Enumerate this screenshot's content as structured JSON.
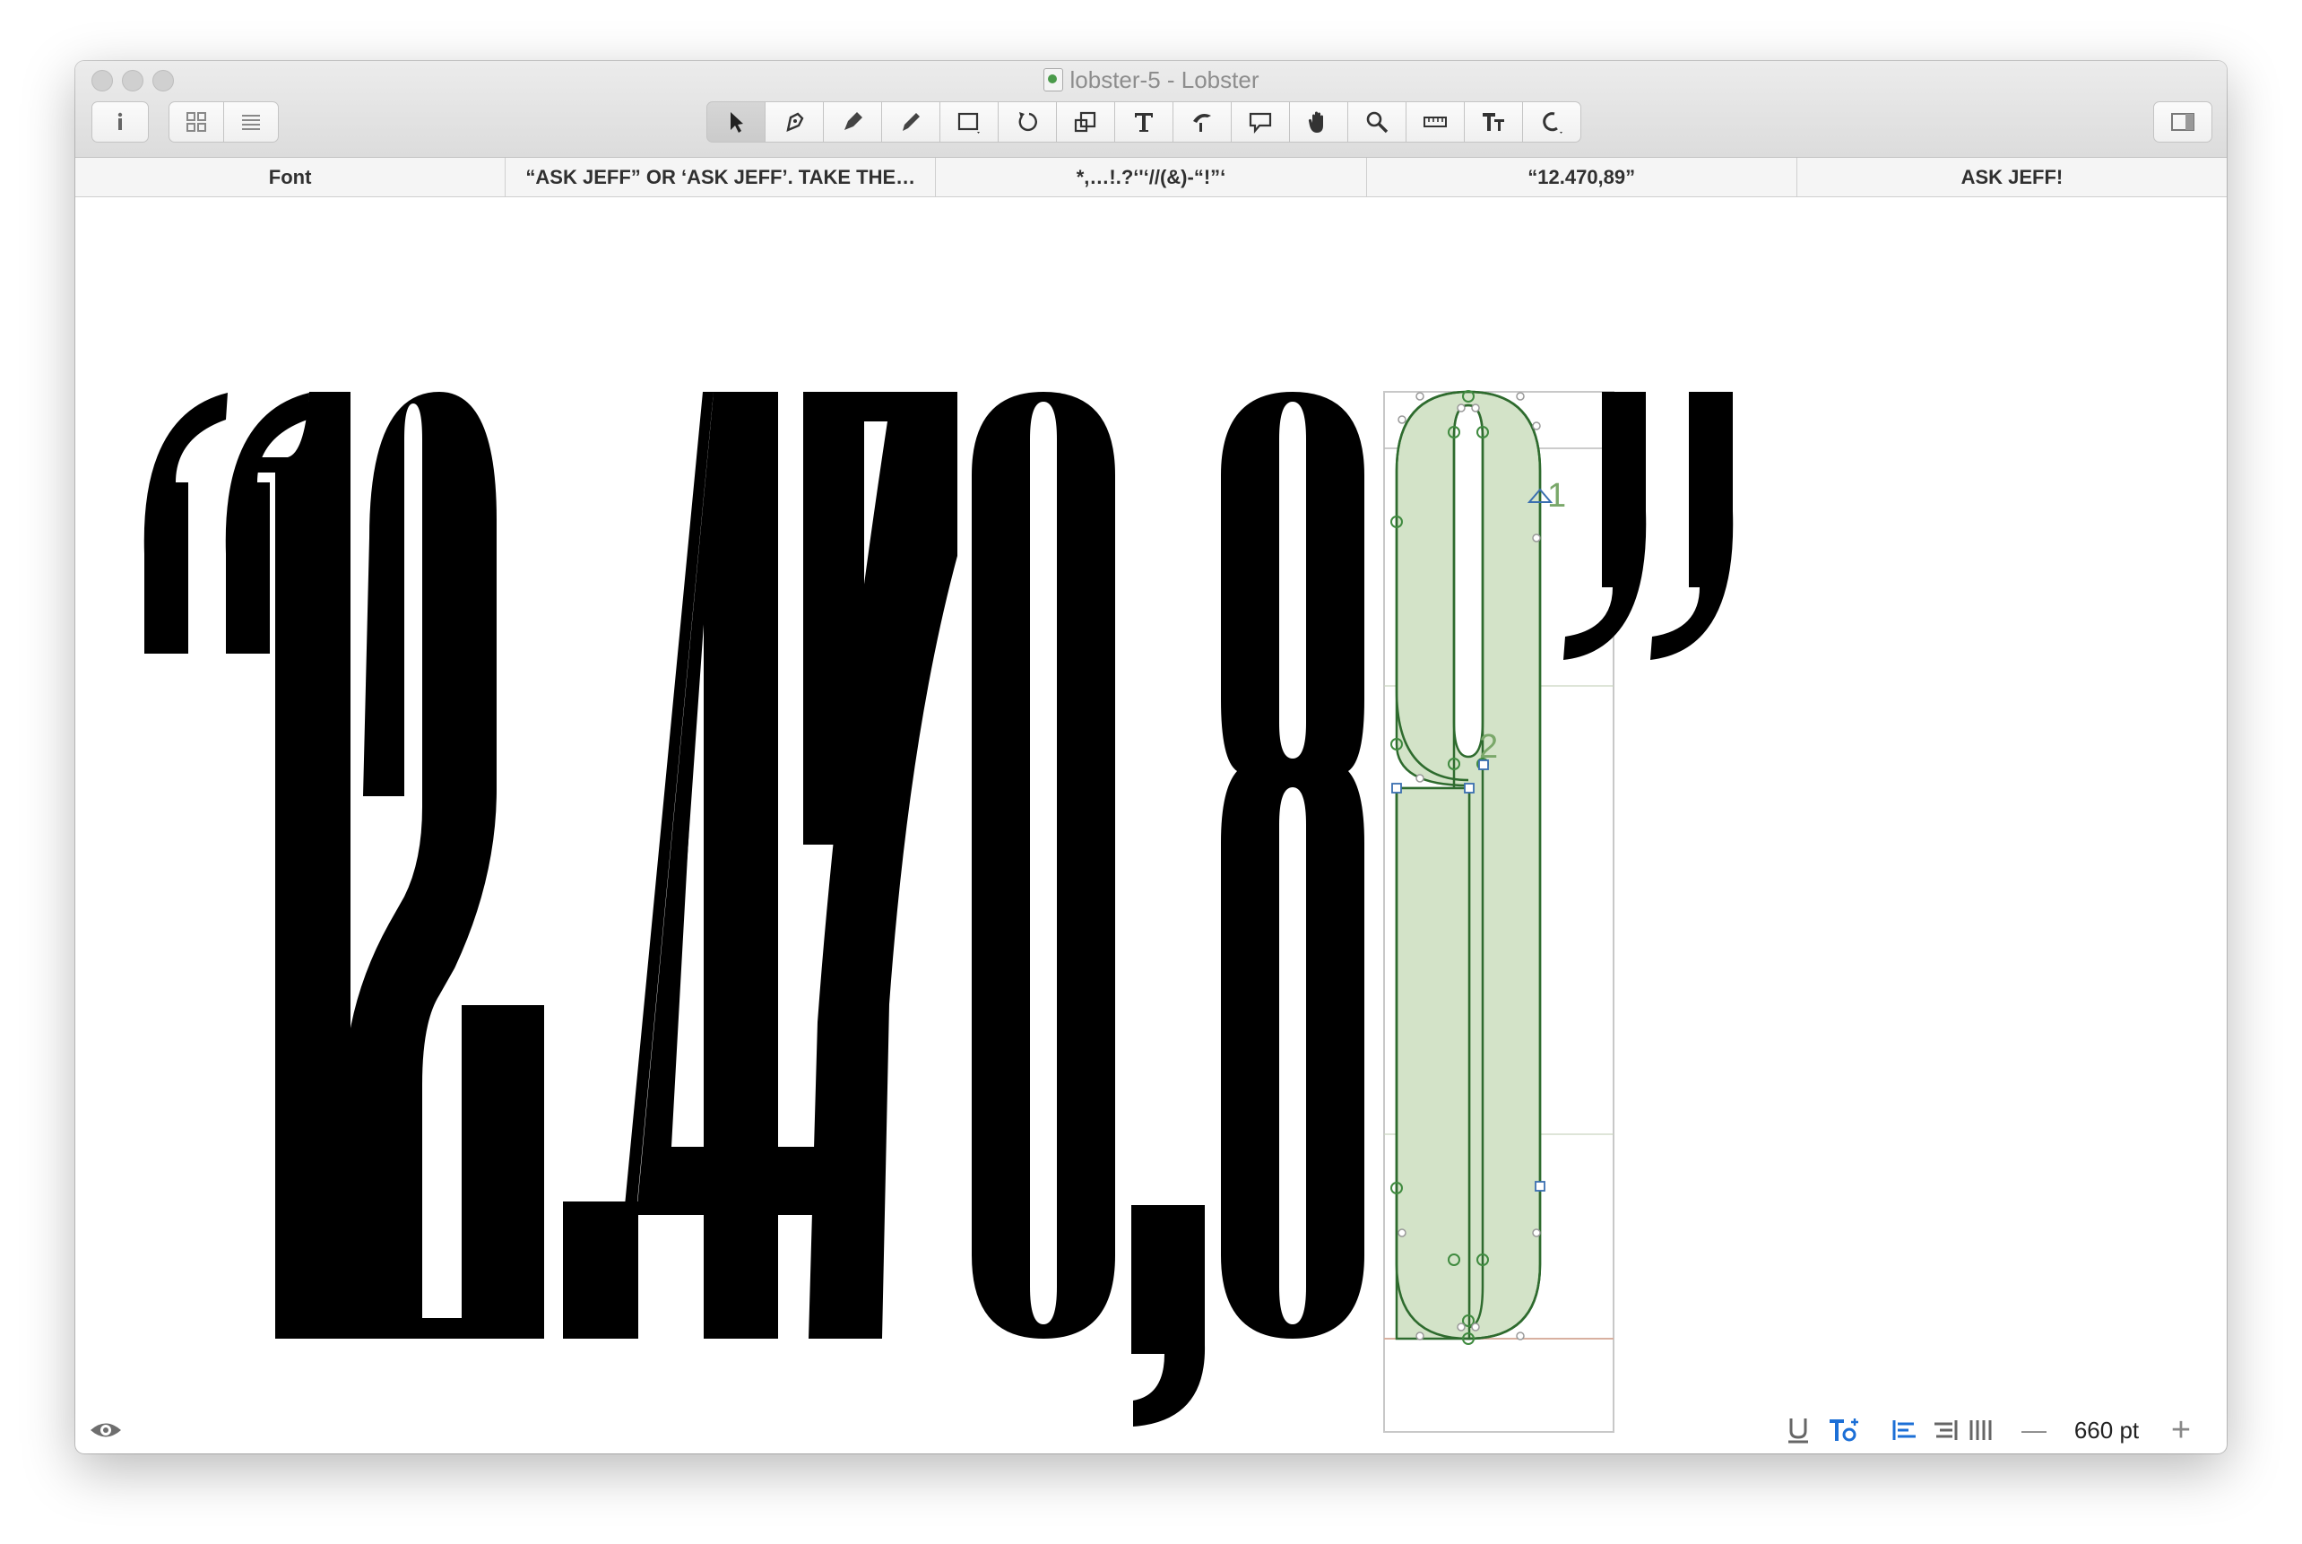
{
  "window": {
    "title": "lobster-5 - Lobster"
  },
  "toolbar": {
    "left_icons": [
      "info-icon",
      "grid-view-icon",
      "list-view-icon"
    ],
    "tools": [
      "select-tool-icon",
      "draw-tool-icon",
      "pen-tool-icon",
      "pencil-tool-icon",
      "rectangle-tool-icon",
      "rotate-tool-icon",
      "scale-tool-icon",
      "text-tool-icon",
      "knife-tool-icon",
      "annotation-tool-icon",
      "hand-tool-icon",
      "zoom-tool-icon",
      "measure-tool-icon",
      "text-size-tool-icon",
      "primitives-tool-icon"
    ],
    "right_icon": "sidebar-toggle-icon"
  },
  "tabs": [
    {
      "label": "Font"
    },
    {
      "label": "“ASK JEFF” OR ‘ASK JEFF’. TAKE THE…"
    },
    {
      "label": "*,…!.?‘'‘//(&)-“!”‘"
    },
    {
      "label": "“12.470,89”"
    },
    {
      "label": "ASK JEFF!"
    }
  ],
  "canvas": {
    "preview_text": "“12.470,8",
    "active_glyph": "9",
    "closing_quote": "”",
    "annotation_1": "1",
    "annotation_2": "2",
    "glyph_fill_color": "#d3e3c8",
    "glyph_outline_color": "#2e6b2e"
  },
  "statusbar": {
    "preview_icon": "eye-icon",
    "underline_icon": "underline-icon",
    "typeface_icon": "text-features-icon",
    "align_left_icon": "align-left-icon",
    "align_right_icon": "align-right-icon",
    "justify_icon": "justify-icon",
    "zoom_out_symbol": "—",
    "font_size": "660 pt",
    "zoom_in_symbol": "+"
  }
}
